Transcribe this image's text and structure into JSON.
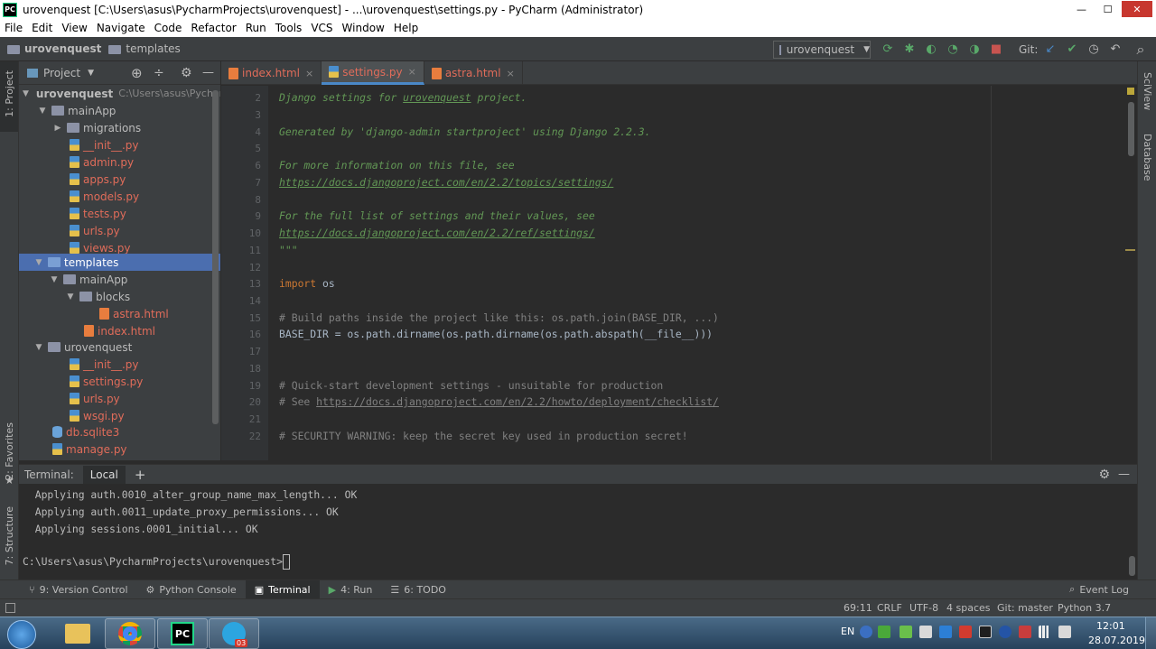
{
  "window": {
    "title": "urovenquest [C:\\Users\\asus\\PycharmProjects\\urovenquest] - ...\\urovenquest\\settings.py - PyCharm (Administrator)",
    "app_logo": "PC",
    "minimize": "—",
    "maximize": "☐",
    "close": "✕"
  },
  "menu": [
    "File",
    "Edit",
    "View",
    "Navigate",
    "Code",
    "Refactor",
    "Run",
    "Tools",
    "VCS",
    "Window",
    "Help"
  ],
  "breadcrumb": {
    "project": "urovenquest",
    "folder": "templates"
  },
  "run_config": {
    "label": "urovenquest",
    "arrow": "▼"
  },
  "git": {
    "label": "Git:"
  },
  "toolbar_icons": {
    "rerun": "⟳",
    "debug": "✱",
    "coverage": "◐",
    "profile": "◔",
    "concurrency": "◑",
    "stop": "■",
    "update": "↙",
    "commit": "✔",
    "history": "◷",
    "revert": "↶",
    "search": "⌕"
  },
  "left_strip": {
    "project": "1: Project",
    "favorites": "2: Favorites",
    "structure": "7: Structure",
    "star": "★"
  },
  "right_strip": {
    "sciview": "SciView",
    "database": "Database"
  },
  "project_panel": {
    "title": "Project",
    "dropdown": "▼",
    "icons": {
      "locate": "⊕",
      "collapse": "÷",
      "settings": "⚙",
      "hide": "—"
    },
    "tree": [
      {
        "label": "urovenquest",
        "path": "C:\\Users\\asus\\Pycharm",
        "arrow": "▼"
      },
      {
        "label": "mainApp",
        "arrow": "▼"
      },
      {
        "label": "migrations",
        "arrow": "▶"
      },
      {
        "label": "__init__.py"
      },
      {
        "label": "admin.py"
      },
      {
        "label": "apps.py"
      },
      {
        "label": "models.py"
      },
      {
        "label": "tests.py"
      },
      {
        "label": "urls.py"
      },
      {
        "label": "views.py"
      },
      {
        "label": "templates",
        "arrow": "▼"
      },
      {
        "label": "mainApp",
        "arrow": "▼"
      },
      {
        "label": "blocks",
        "arrow": "▼"
      },
      {
        "label": "astra.html"
      },
      {
        "label": "index.html"
      },
      {
        "label": "urovenquest",
        "arrow": "▼"
      },
      {
        "label": "__init__.py"
      },
      {
        "label": "settings.py"
      },
      {
        "label": "urls.py"
      },
      {
        "label": "wsgi.py"
      },
      {
        "label": "db.sqlite3"
      },
      {
        "label": "manage.py"
      }
    ]
  },
  "tabs": [
    {
      "label": "index.html",
      "close": "×"
    },
    {
      "label": "settings.py",
      "close": "×"
    },
    {
      "label": "astra.html",
      "close": "×"
    }
  ],
  "editor": {
    "line_numbers": [
      "2",
      "3",
      "4",
      "5",
      "6",
      "7",
      "8",
      "9",
      "10",
      "11",
      "12",
      "13",
      "14",
      "15",
      "16",
      "17",
      "18",
      "19",
      "20",
      "21",
      "22"
    ],
    "l2a": "Django settings for ",
    "l2b": "urovenquest",
    "l2c": " project.",
    "l4": "Generated by 'django-admin startproject' using Django 2.2.3.",
    "l6": "For more information on this file, see",
    "l7": "https://docs.djangoproject.com/en/2.2/topics/settings/",
    "l9": "For the full list of settings and their values, see",
    "l10": "https://docs.djangoproject.com/en/2.2/ref/settings/",
    "l11": "\"\"\"",
    "l13a": "import",
    "l13b": " os",
    "l15": "# Build paths inside the project like this: os.path.join(BASE_DIR, ...)",
    "l16": "BASE_DIR = os.path.dirname(os.path.dirname(os.path.abspath(__file__)))",
    "l19": "# Quick-start development settings - unsuitable for production",
    "l20a": "# See ",
    "l20b": "https://docs.djangoproject.com/en/2.2/howto/deployment/checklist/",
    "l22": "# SECURITY WARNING: keep the secret key used in production secret!"
  },
  "terminal": {
    "title": "Terminal:",
    "tab": "Local",
    "add": "+",
    "lines": [
      "  Applying auth.0010_alter_group_name_max_length... OK",
      "  Applying auth.0011_update_proxy_permissions... OK",
      "  Applying sessions.0001_initial... OK"
    ],
    "prompt": "C:\\Users\\asus\\PycharmProjects\\urovenquest>"
  },
  "tool_windows": [
    {
      "label": "9: Version Control",
      "icon": "⑂"
    },
    {
      "label": "Python Console",
      "icon": "⚙"
    },
    {
      "label": "Terminal",
      "icon": "▣"
    },
    {
      "label": "4: Run",
      "icon": "▶"
    },
    {
      "label": "6: TODO",
      "icon": "☰"
    }
  ],
  "event_log": "Event Log",
  "status": {
    "position": "69:11",
    "line_sep": "CRLF",
    "encoding": "UTF-8",
    "indent": "4 spaces",
    "git": "Git: master",
    "interpreter": "Python 3.7"
  },
  "taskbar": {
    "lang": "EN",
    "time": "12:01",
    "date": "28.07.2019",
    "telegram_badge": "03"
  }
}
